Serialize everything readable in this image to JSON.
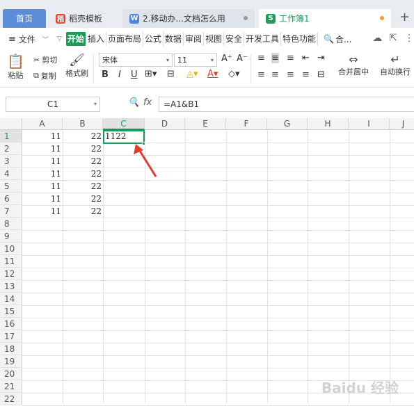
{
  "tabs": {
    "home": "首页",
    "daoke": "稻壳模板",
    "doc": "2.移动办...文档怎么用",
    "book": "工作簿1",
    "daoke_icon": "稻",
    "doc_icon": "W",
    "book_icon": "S"
  },
  "menu": {
    "hamburger": "≡",
    "file": "文件",
    "items": [
      "开始",
      "插入",
      "页面布局",
      "公式",
      "数据",
      "审阅",
      "视图",
      "安全",
      "开发工具",
      "特色功能"
    ],
    "search": "合..."
  },
  "ribbon": {
    "paste": "粘贴",
    "cut": "剪切",
    "copy": "复制",
    "format_painter": "格式刷",
    "font_name": "宋体",
    "font_size": "11",
    "merge_center": "合并居中",
    "auto_wrap": "自动换行",
    "bold": "B",
    "italic": "I",
    "underline": "U"
  },
  "formula_bar": {
    "name_box": "C1",
    "fx": "fx",
    "formula": "=A1&B1"
  },
  "sheet": {
    "columns": [
      "A",
      "B",
      "C",
      "D",
      "E",
      "F",
      "G",
      "H",
      "I",
      "J"
    ],
    "rows": [
      "1",
      "2",
      "3",
      "4",
      "5",
      "6",
      "7",
      "8",
      "9",
      "10",
      "11",
      "12",
      "13",
      "14",
      "15",
      "16",
      "17",
      "18",
      "19",
      "20",
      "21",
      "22"
    ],
    "data": [
      {
        "a": "11",
        "b": "22",
        "c": "1122"
      },
      {
        "a": "11",
        "b": "22",
        "c": ""
      },
      {
        "a": "11",
        "b": "22",
        "c": ""
      },
      {
        "a": "11",
        "b": "22",
        "c": ""
      },
      {
        "a": "11",
        "b": "22",
        "c": ""
      },
      {
        "a": "11",
        "b": "22",
        "c": ""
      },
      {
        "a": "11",
        "b": "22",
        "c": ""
      }
    ],
    "selected_cell": "C1",
    "accent_color": "#1a9b5a",
    "arrow_color": "#e03c31"
  },
  "watermark": "Baidu 经验"
}
